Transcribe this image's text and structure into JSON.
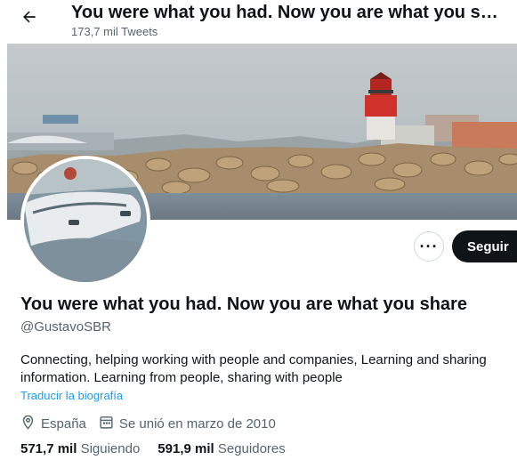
{
  "header": {
    "title": "You were what you had. Now you are what you share",
    "tweets_count": "173,7 mil Tweets",
    "back_icon": "arrow-left-icon"
  },
  "profile": {
    "display_name": "You were what you had. Now you are what you share",
    "handle": "@GustavoSBR",
    "bio_line1": "Connecting, helping working with people and companies, Learning and sharing",
    "bio_line2": "information. Learning from people, sharing with people",
    "translate_label": "Traducir la biografía",
    "location": "España",
    "joined": "Se unió en marzo de 2010",
    "following_count": "571,7 mil",
    "following_label": "Siguiendo",
    "followers_count": "591,9 mil",
    "followers_label": "Seguidores"
  },
  "actions": {
    "more_label": "···",
    "follow_label": "Seguir"
  },
  "colors": {
    "text_primary": "#0f1419",
    "text_secondary": "#536471",
    "link": "#1d9bf0",
    "button_dark": "#0f1419"
  }
}
